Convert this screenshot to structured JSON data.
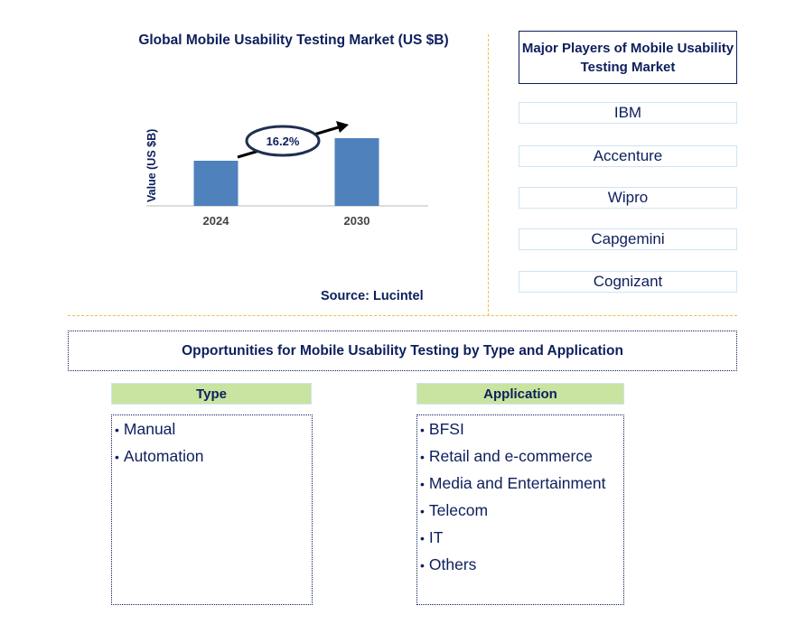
{
  "chart_data": {
    "type": "bar",
    "title": "Global Mobile Usability Testing Market (US $B)",
    "xlabel": "",
    "ylabel": "Value (US $B)",
    "categories": [
      "2024",
      "2030"
    ],
    "values": [
      1.0,
      1.5
    ],
    "value_units": "relative (no axis scale shown)",
    "annotation": "16.2%",
    "annotation_meaning": "CAGR 2024-2030",
    "bar_color": "#4f81bd",
    "grid": false,
    "legend": "none"
  },
  "source": "Source: Lucintel",
  "players": {
    "title": "Major Players of Mobile Usability Testing Market",
    "items": [
      "IBM",
      "Accenture",
      "Wipro",
      "Capgemini",
      "Cognizant"
    ]
  },
  "opportunities": {
    "title": "Opportunities for Mobile Usability Testing by Type and Application",
    "type": {
      "header": "Type",
      "items": [
        "Manual",
        "Automation"
      ]
    },
    "application": {
      "header": "Application",
      "items": [
        "BFSI",
        "Retail and e-commerce",
        "Media and Entertainment",
        "Telecom",
        "IT",
        "Others"
      ]
    },
    "header_color": "#c8e4a0",
    "bullet": "•"
  }
}
